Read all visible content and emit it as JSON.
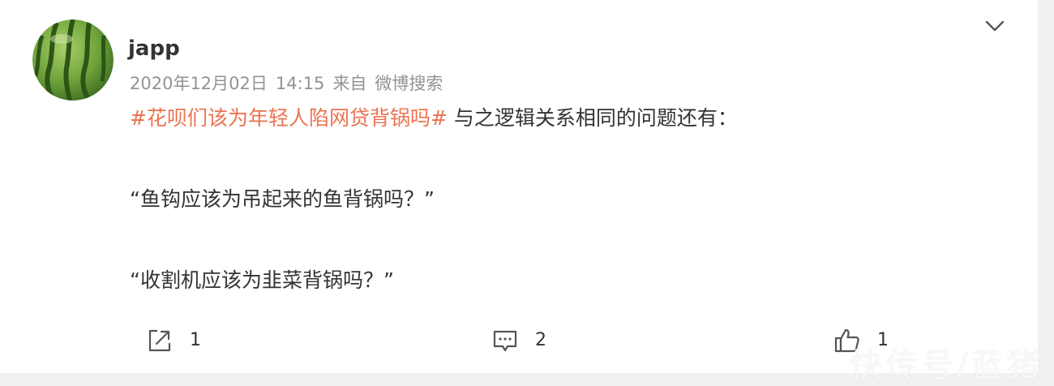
{
  "post": {
    "author": "japp",
    "date": "2020年12月02日",
    "time": "14:15",
    "source_prefix": "来自",
    "source": "微博搜索",
    "topic": "#花呗们该为年轻人陷网贷背锅吗#",
    "line1_rest": " 与之逻辑关系相同的问题还有：",
    "line2": "“鱼钩应该为吊起来的鱼背锅吗？”",
    "line3": "“收割机应该为韭菜背锅吗？”"
  },
  "actions": {
    "forward_count": "1",
    "comment_count": "2",
    "like_count": "1"
  },
  "icons": {
    "menu": "chevron-down-icon",
    "forward": "forward-icon",
    "comment": "comment-icon",
    "like": "thumbs-up-icon"
  },
  "watermark": "快传号/蓝猪",
  "colors": {
    "topic": "#eb7350",
    "text": "#333333",
    "meta": "#939393"
  }
}
